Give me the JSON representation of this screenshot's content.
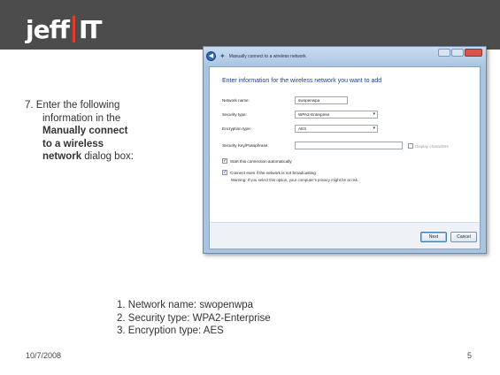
{
  "logo": {
    "part1": "jeff",
    "part2": "IT"
  },
  "step": {
    "line1": "7. Enter the following",
    "line2": "information in the",
    "bold1": "Manually connect",
    "bold2": "to a wireless",
    "bold3": "network",
    "tail": " dialog box:"
  },
  "dialog": {
    "title": "Manually connect to a wireless network",
    "heading": "Enter information for the wireless network you want to add",
    "labels": {
      "network_name": "Network name:",
      "security_type": "Security type:",
      "encryption_type": "Encryption type:",
      "security_key": "Security Key/Passphrase:"
    },
    "values": {
      "network_name": "swopenwpa",
      "security_type": "WPA2-Enterprise",
      "encryption_type": "AES",
      "security_key": ""
    },
    "display_characters": "Display characters",
    "start_auto": "Start this connection automatically",
    "connect_even": "Connect even if the network is not broadcasting",
    "warning": "Warning: If you select this option, your computer's privacy might be at risk.",
    "next": "Next",
    "cancel": "Cancel"
  },
  "summary": {
    "item1": "1. Network name: swopenwpa",
    "item2": "2. Security type: WPA2-Enterprise",
    "item3": "3. Encryption type: AES"
  },
  "footer": {
    "date": "10/7/2008",
    "page": "5"
  }
}
